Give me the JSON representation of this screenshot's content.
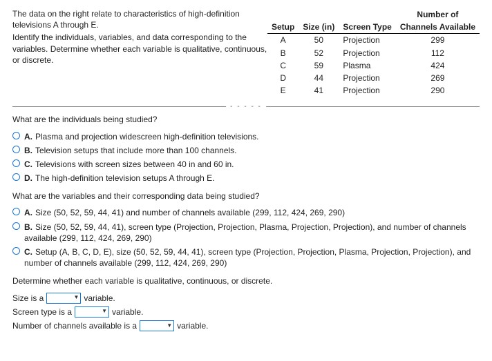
{
  "prompt": {
    "line1": "The data on the right relate to characteristics of high-definition televisions A through E.",
    "line2": "Identify the individuals, variables, and data corresponding to the variables. Determine whether each variable is qualitative, continuous, or discrete."
  },
  "table": {
    "headers": {
      "setup": "Setup",
      "size": "Size (in)",
      "screen": "Screen Type",
      "channels_top": "Number of",
      "channels_bot": "Channels Available"
    },
    "rows": [
      {
        "setup": "A",
        "size": "50",
        "screen": "Projection",
        "channels": "299"
      },
      {
        "setup": "B",
        "size": "52",
        "screen": "Projection",
        "channels": "112"
      },
      {
        "setup": "C",
        "size": "59",
        "screen": "Plasma",
        "channels": "424"
      },
      {
        "setup": "D",
        "size": "44",
        "screen": "Projection",
        "channels": "269"
      },
      {
        "setup": "E",
        "size": "41",
        "screen": "Projection",
        "channels": "290"
      }
    ]
  },
  "q1": {
    "text": "What are the individuals being studied?",
    "A": "Plasma and projection widescreen high-definition televisions.",
    "B": "Television setups that include more than 100 channels.",
    "C": "Televisions with screen sizes between 40 in and 60 in.",
    "D": "The high-definition television setups A through E."
  },
  "q2": {
    "text": "What are the variables and their corresponding data being studied?",
    "A": "Size (50, 52, 59, 44, 41) and number of channels available (299, 112, 424, 269, 290)",
    "B": "Size (50, 52, 59, 44, 41), screen type (Projection, Projection, Plasma, Projection, Projection), and number of channels available (299, 112, 424, 269, 290)",
    "C": "Setup (A, B, C, D, E), size (50, 52, 59, 44, 41), screen type (Projection, Projection, Plasma, Projection, Projection), and number of channels available (299, 112, 424, 269, 290)"
  },
  "q3": {
    "text": "Determine whether each variable is qualitative, continuous, or discrete.",
    "row1_pre": "Size is a",
    "row1_post": "variable.",
    "row2_pre": "Screen type is a",
    "row2_post": "variable.",
    "row3_pre": "Number of channels available is a",
    "row3_post": "variable."
  },
  "letters": {
    "A": "A.",
    "B": "B.",
    "C": "C.",
    "D": "D."
  },
  "dots": "- - - - -"
}
